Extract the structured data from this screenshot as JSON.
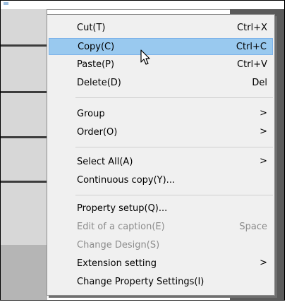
{
  "context_menu": {
    "items": [
      {
        "label": "Cut(T)",
        "shortcut": "Ctrl+X"
      },
      {
        "label": "Copy(C)",
        "shortcut": "Ctrl+C",
        "selected": true
      },
      {
        "label": "Paste(P)",
        "shortcut": "Ctrl+V"
      },
      {
        "label": "Delete(D)",
        "shortcut": "Del"
      },
      {
        "label": "Group",
        "arrow": ">"
      },
      {
        "label": "Order(O)",
        "arrow": ">"
      },
      {
        "label": "Select All(A)",
        "arrow": ">"
      },
      {
        "label": "Continuous copy(Y)..."
      },
      {
        "label": "Property setup(Q)..."
      },
      {
        "label": "Edit of a caption(E)",
        "shortcut": "Space",
        "disabled": true
      },
      {
        "label": "Change Design(S)",
        "disabled": true
      },
      {
        "label": "Extension setting",
        "arrow": ">"
      },
      {
        "label": "Change Property Settings(I)"
      }
    ]
  },
  "colors": {
    "menu_background": "#f0f0f0",
    "highlight": "#99c9ef",
    "disabled_text": "#8c8c8c",
    "dark_panel": "#5b5b5b"
  },
  "icons": {
    "cursor": "mouse-pointer-icon",
    "submenu": "chevron-right-icon"
  }
}
